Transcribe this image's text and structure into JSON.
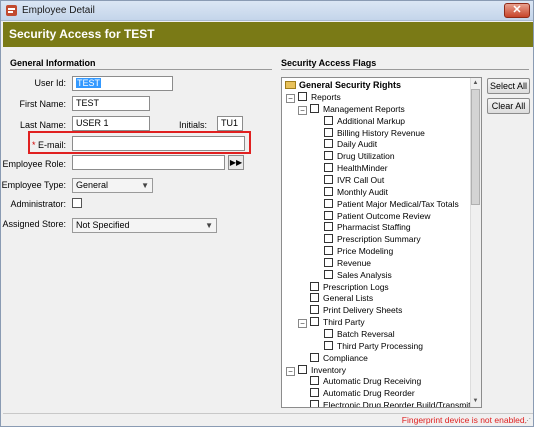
{
  "window": {
    "title": "Employee Detail",
    "close_glyph": "✕"
  },
  "header": {
    "title": "Security Access for TEST",
    "band_color": "#7a7a16"
  },
  "general": {
    "section_title": "General Information",
    "user_id": {
      "label": "User Id:",
      "value": "TEST"
    },
    "first_name": {
      "label": "First Name:",
      "value": "TEST"
    },
    "last_name": {
      "label": "Last Name:",
      "value": "USER 1"
    },
    "initials": {
      "label": "Initials:",
      "value": "TU1"
    },
    "email": {
      "required_mark": "*",
      "label": "E-mail:",
      "value": ""
    },
    "employee_role": {
      "label": "Employee Role:",
      "value": "",
      "button": "▶▶"
    },
    "employee_type": {
      "label": "Employee Type:",
      "value": "General"
    },
    "administrator": {
      "label": "Administrator:",
      "checked": false
    },
    "assigned_store": {
      "label": "Assigned Store:",
      "value": "Not Specified"
    }
  },
  "flags": {
    "section_title": "Security Access Flags",
    "root": "General Security Rights",
    "items": [
      {
        "label": "Reports",
        "level": 1,
        "expander": "−"
      },
      {
        "label": "Management Reports",
        "level": 2,
        "expander": "−"
      },
      {
        "label": "Additional Markup",
        "level": 3
      },
      {
        "label": "Billing History Revenue",
        "level": 3
      },
      {
        "label": "Daily Audit",
        "level": 3
      },
      {
        "label": "Drug Utilization",
        "level": 3
      },
      {
        "label": "HealthMinder",
        "level": 3
      },
      {
        "label": "IVR Call Out",
        "level": 3
      },
      {
        "label": "Monthly Audit",
        "level": 3
      },
      {
        "label": "Patient Major Medical/Tax Totals",
        "level": 3
      },
      {
        "label": "Patient Outcome Review",
        "level": 3
      },
      {
        "label": "Pharmacist Staffing",
        "level": 3
      },
      {
        "label": "Prescription Summary",
        "level": 3
      },
      {
        "label": "Price Modeling",
        "level": 3
      },
      {
        "label": "Revenue",
        "level": 3
      },
      {
        "label": "Sales Analysis",
        "level": 3
      },
      {
        "label": "Prescription Logs",
        "level": 2
      },
      {
        "label": "General Lists",
        "level": 2
      },
      {
        "label": "Print Delivery Sheets",
        "level": 2
      },
      {
        "label": "Third Party",
        "level": 2,
        "expander": "−"
      },
      {
        "label": "Batch Reversal",
        "level": 3
      },
      {
        "label": "Third Party Processing",
        "level": 3
      },
      {
        "label": "Compliance",
        "level": 2
      },
      {
        "label": "Inventory",
        "level": 1,
        "expander": "−"
      },
      {
        "label": "Automatic Drug Receiving",
        "level": 2
      },
      {
        "label": "Automatic Drug Reorder",
        "level": 2
      },
      {
        "label": "Electronic Drug Reorder Build/Transmit",
        "level": 2
      }
    ],
    "select_all": "Select All",
    "clear_all": "Clear All"
  },
  "status": {
    "message": "Fingerprint device is not enabled."
  },
  "icons": {
    "combo_arrow": "▼",
    "scroll_up": "▲",
    "scroll_down": "▼",
    "grip": "⋰"
  },
  "colors": {
    "required": "#e02020",
    "highlight": "#e02020"
  }
}
